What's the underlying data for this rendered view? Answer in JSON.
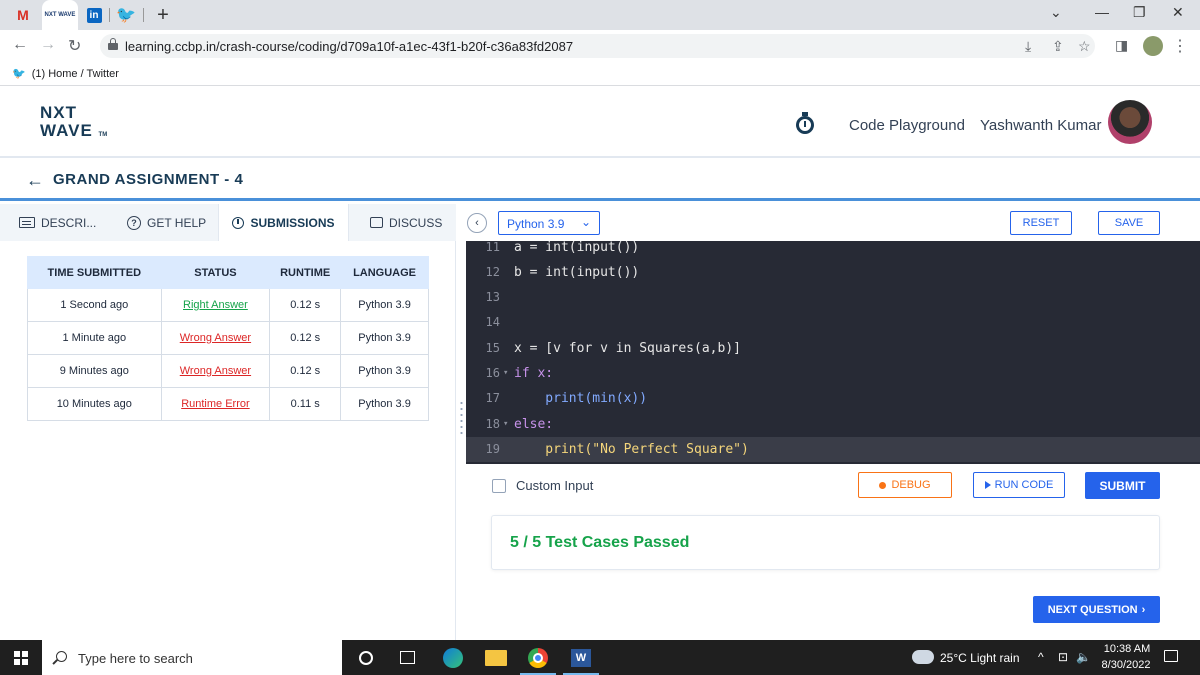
{
  "browser": {
    "tabs": [
      {
        "icon": "gmail-icon",
        "glyph": "M"
      },
      {
        "icon": "nxtwave-icon",
        "glyph": "NXT WAVE"
      },
      {
        "icon": "linkedin-icon",
        "glyph": "in"
      },
      {
        "icon": "twitter-icon",
        "glyph": "🐦"
      }
    ],
    "new_tab": "+",
    "url": "learning.ccbp.in/crash-course/coding/d709a10f-a1ec-43f1-b20f-c36a83fd2087",
    "bookmark": "(1) Home / Twitter"
  },
  "header": {
    "logo_line1": "NXT",
    "logo_line2": "WAVE",
    "logo_tm": "TM",
    "code_playground": "Code Playground",
    "user_name": "Yashwanth Kumar"
  },
  "assignment": {
    "title": "GRAND ASSIGNMENT - 4"
  },
  "left_tabs": {
    "description": "DESCRI...",
    "get_help": "GET HELP",
    "submissions": "SUBMISSIONS",
    "discuss": "DISCUSS"
  },
  "submissions": {
    "headers": [
      "TIME SUBMITTED",
      "STATUS",
      "RUNTIME",
      "LANGUAGE"
    ],
    "rows": [
      {
        "time": "1 Second ago",
        "status": "Right Answer",
        "runtime": "0.12 s",
        "language": "Python 3.9"
      },
      {
        "time": "1 Minute ago",
        "status": "Wrong Answer",
        "runtime": "0.12 s",
        "language": "Python 3.9"
      },
      {
        "time": "9 Minutes ago",
        "status": "Wrong Answer",
        "runtime": "0.12 s",
        "language": "Python 3.9"
      },
      {
        "time": "10 Minutes ago",
        "status": "Runtime Error",
        "runtime": "0.11 s",
        "language": "Python 3.9"
      }
    ]
  },
  "editor": {
    "language": "Python 3.9",
    "reset": "RESET",
    "save": "SAVE",
    "lines": [
      {
        "num": "11",
        "text": "a = int(input())"
      },
      {
        "num": "12",
        "text": "b = int(input())"
      },
      {
        "num": "13",
        "text": ""
      },
      {
        "num": "14",
        "text": ""
      },
      {
        "num": "15",
        "text": "x = [v for v in Squares(a,b)]"
      },
      {
        "num": "16",
        "text": "if x:"
      },
      {
        "num": "17",
        "text": "    print(min(x))"
      },
      {
        "num": "18",
        "text": "else:"
      },
      {
        "num": "19",
        "text": "    print(\"No Perfect Square\")"
      }
    ]
  },
  "actions": {
    "custom_input": "Custom Input",
    "debug": "DEBUG",
    "run_code": "RUN CODE",
    "submit": "SUBMIT",
    "result": "5 / 5 Test Cases Passed",
    "next_question": "NEXT QUESTION"
  },
  "taskbar": {
    "search_placeholder": "Type here to search",
    "weather": "25°C  Light rain",
    "time": "10:38 AM",
    "date": "8/30/2022"
  },
  "colors": {
    "primary": "#2563eb",
    "success": "#16a34a",
    "error": "#dc2626",
    "debug": "#f97316",
    "editor_bg": "#272a35"
  }
}
